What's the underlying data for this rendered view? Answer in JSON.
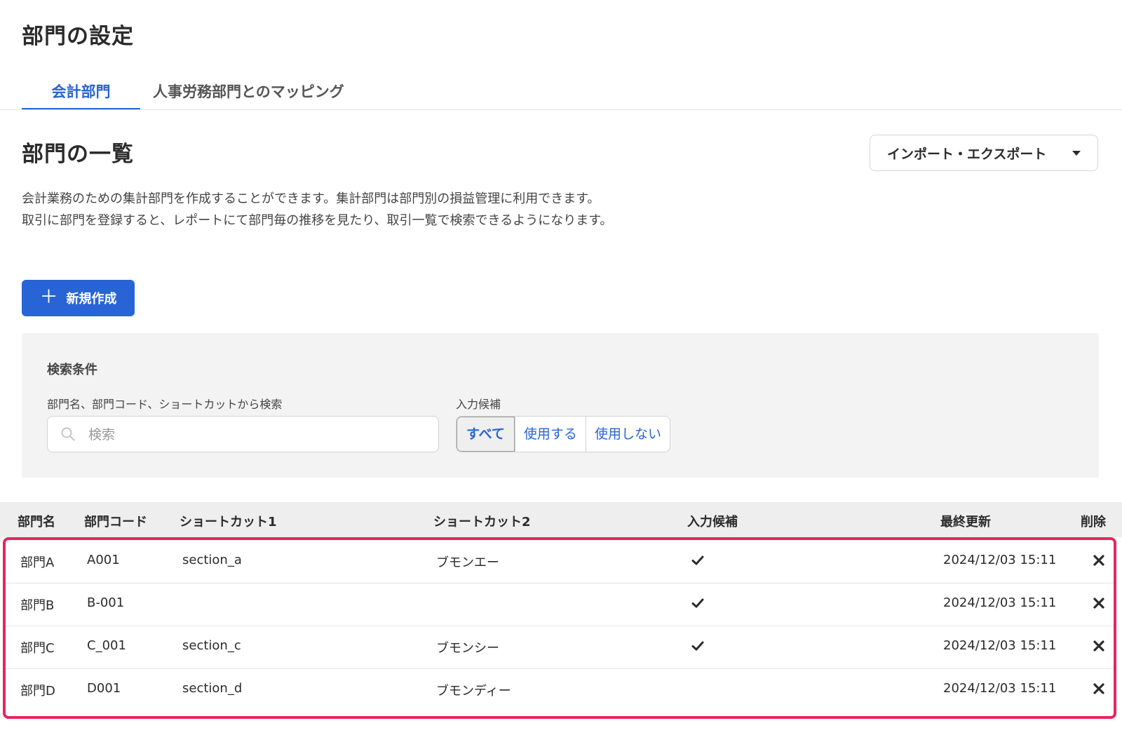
{
  "page": {
    "title": "部門の設定"
  },
  "tabs": [
    {
      "label": "会計部門",
      "active": true
    },
    {
      "label": "人事労務部門とのマッピング",
      "active": false
    }
  ],
  "section": {
    "title": "部門の一覧",
    "import_export_label": "インポート・エクスポート",
    "description_lines": [
      "会計業務のための集計部門を作成することができます。集計部門は部門別の損益管理に利用できます。",
      "取引に部門を登録すると、レポートにて部門毎の推移を見たり、取引一覧で検索できるようになります。"
    ],
    "new_button_label": "新規作成"
  },
  "search": {
    "heading": "検索条件",
    "field_label": "部門名、部門コード、ショートカットから検索",
    "placeholder": "検索",
    "value": "",
    "candidate_label": "入力候補",
    "candidate_options": [
      "すべて",
      "使用する",
      "使用しない"
    ],
    "candidate_selected": "すべて"
  },
  "table": {
    "columns": [
      "部門名",
      "部門コード",
      "ショートカット1",
      "ショートカット2",
      "入力候補",
      "最終更新",
      "削除"
    ],
    "rows": [
      {
        "name": "部門A",
        "code": "A001",
        "shortcut1": "section_a",
        "shortcut2": "ブモンエー",
        "candidate": true,
        "updated": "2024/12/03 15:11"
      },
      {
        "name": "部門B",
        "code": "B-001",
        "shortcut1": "",
        "shortcut2": "",
        "candidate": true,
        "updated": "2024/12/03 15:11"
      },
      {
        "name": "部門C",
        "code": "C_001",
        "shortcut1": "section_c",
        "shortcut2": "ブモンシー",
        "candidate": true,
        "updated": "2024/12/03 15:11"
      },
      {
        "name": "部門D",
        "code": "D001",
        "shortcut1": "section_d",
        "shortcut2": "ブモンディー",
        "candidate": false,
        "updated": "2024/12/03 15:11"
      }
    ]
  },
  "colors": {
    "accent": "#2864d6",
    "highlight_frame": "#e8265e",
    "panel_bg": "#f4f3f3",
    "header_bg": "#efeeee"
  },
  "icons": {
    "check": "check-icon",
    "delete": "close-icon",
    "search": "search-icon",
    "add": "plus-icon",
    "dropdown": "chevron-down-icon"
  }
}
